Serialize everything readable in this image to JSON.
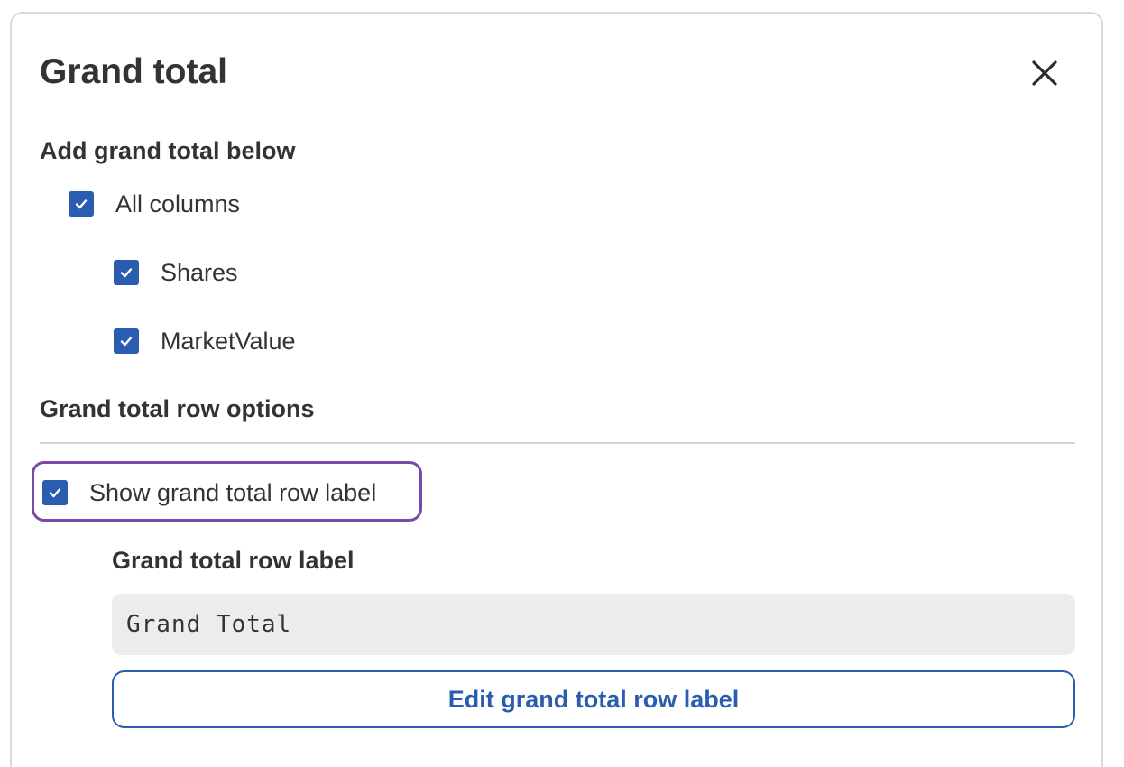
{
  "dialog": {
    "title": "Grand total",
    "close_icon": "close-icon"
  },
  "add_section": {
    "heading": "Add grand total below",
    "all_columns": {
      "label": "All columns",
      "checked": true
    },
    "columns": [
      {
        "label": "Shares",
        "checked": true
      },
      {
        "label": "MarketValue",
        "checked": true
      }
    ]
  },
  "row_options": {
    "heading": "Grand total row options",
    "show_label": {
      "label": "Show grand total row label",
      "checked": true
    },
    "field_label": "Grand total row label",
    "field_value": "Grand Total",
    "edit_button_label": "Edit grand total row label"
  },
  "colors": {
    "accent": "#2a5db0",
    "highlight": "#7b4aa8",
    "field_background": "#ececec"
  }
}
